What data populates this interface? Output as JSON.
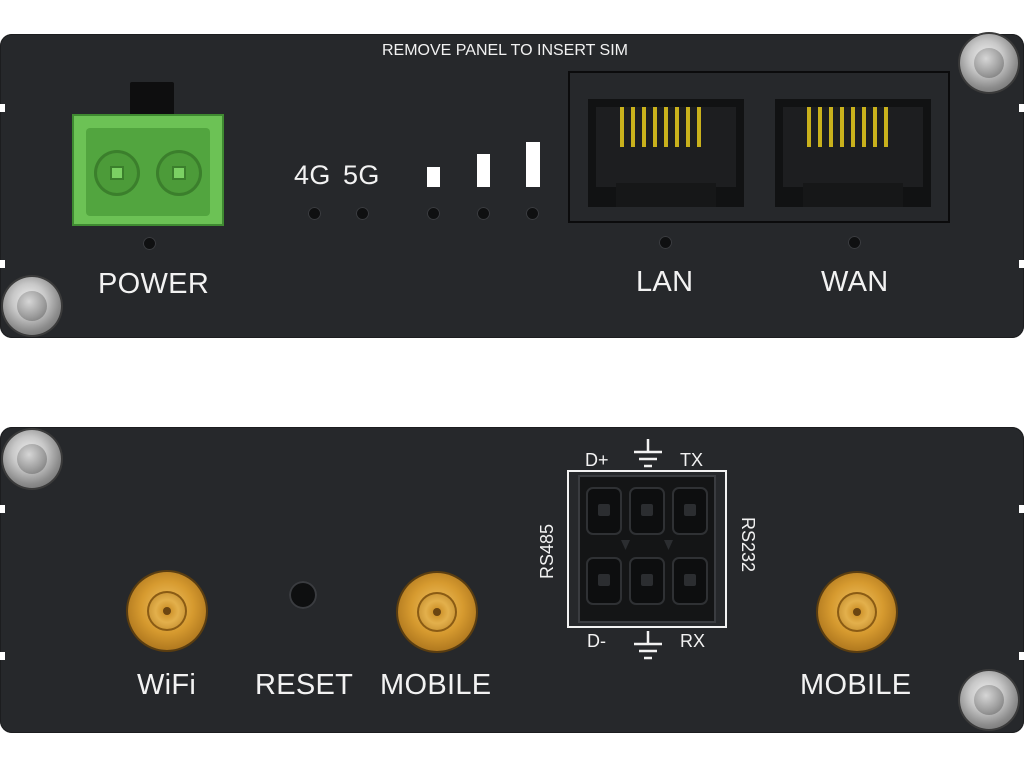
{
  "front_panel": {
    "sim_note": "REMOVE PANEL TO INSERT SIM",
    "power_label": "POWER",
    "led_4g_label": "4G",
    "led_5g_label": "5G",
    "lan_label": "LAN",
    "wan_label": "WAN"
  },
  "back_panel": {
    "wifi_label": "WiFi",
    "reset_label": "RESET",
    "mobile_label_1": "MOBILE",
    "mobile_label_2": "MOBILE",
    "serial": {
      "d_plus": "D+",
      "tx": "TX",
      "d_minus": "D-",
      "rx": "RX",
      "rs485": "RS485",
      "rs232": "RS232"
    }
  },
  "colors": {
    "panel": "#26282b",
    "power_connector": "#5bb54a",
    "rj45_pins": "#c9b11c",
    "antenna_connector": "#d69a2f"
  },
  "icons": {
    "ground": "ground-icon"
  }
}
